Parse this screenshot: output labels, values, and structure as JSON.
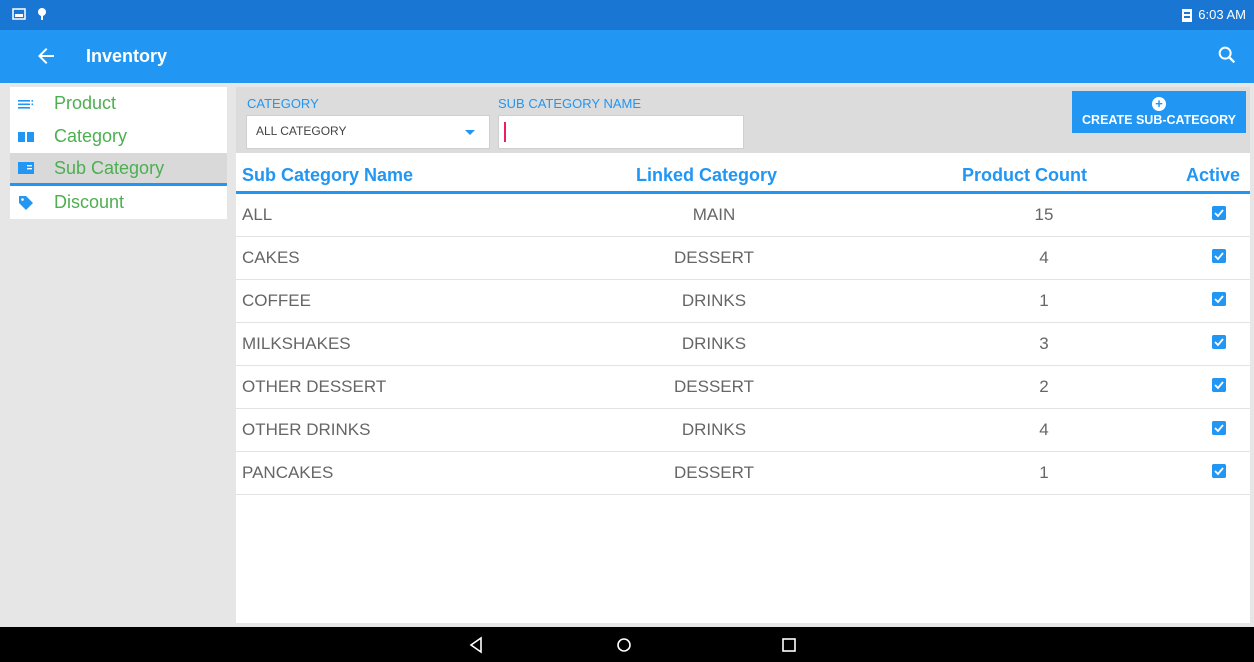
{
  "status_bar": {
    "time": "6:03 AM",
    "icons": [
      "image-icon",
      "location-icon",
      "battery-icon"
    ]
  },
  "app_bar": {
    "title": "Inventory"
  },
  "sidebar": {
    "items": [
      {
        "label": "Product",
        "icon": "list-icon",
        "selected": false
      },
      {
        "label": "Category",
        "icon": "book-icon",
        "selected": false
      },
      {
        "label": "Sub Category",
        "icon": "book-open-icon",
        "selected": true
      },
      {
        "label": "Discount",
        "icon": "tag-icon",
        "selected": false
      }
    ]
  },
  "filters": {
    "category_label": "CATEGORY",
    "category_value": "ALL CATEGORY",
    "subcategory_label": "SUB CATEGORY NAME",
    "subcategory_value": "",
    "create_button": "CREATE SUB-CATEGORY"
  },
  "table": {
    "columns": [
      "Sub Category Name",
      "Linked Category",
      "Product Count",
      "Active"
    ],
    "rows": [
      {
        "name": "ALL",
        "linked": "MAIN",
        "count": "15",
        "active": true
      },
      {
        "name": "CAKES",
        "linked": "DESSERT",
        "count": "4",
        "active": true
      },
      {
        "name": "COFFEE",
        "linked": "DRINKS",
        "count": "1",
        "active": true
      },
      {
        "name": "MILKSHAKES",
        "linked": "DRINKS",
        "count": "3",
        "active": true
      },
      {
        "name": "OTHER DESSERT",
        "linked": "DESSERT",
        "count": "2",
        "active": true
      },
      {
        "name": "OTHER DRINKS",
        "linked": "DRINKS",
        "count": "4",
        "active": true
      },
      {
        "name": "PANCAKES",
        "linked": "DESSERT",
        "count": "1",
        "active": true
      }
    ]
  },
  "colors": {
    "primary": "#2196f3",
    "status_bar": "#1976d2",
    "accent_green": "#4caf50",
    "caret": "#e91e63"
  }
}
